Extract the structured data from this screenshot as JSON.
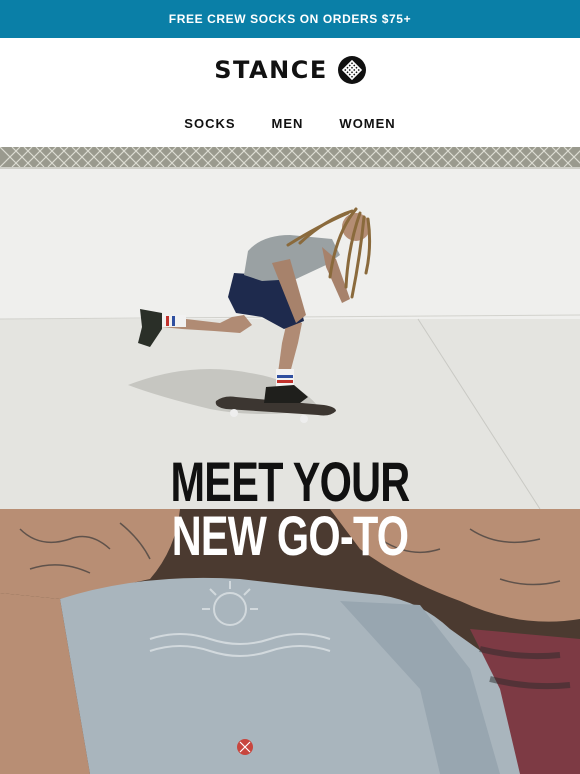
{
  "promo": {
    "text": "FREE CREW SOCKS ON ORDERS $75+"
  },
  "brand": {
    "wordmark": "STANCE",
    "logo_icon": "stance-emblem-icon"
  },
  "nav": {
    "items": [
      {
        "label": "SOCKS"
      },
      {
        "label": "MEN"
      },
      {
        "label": "WOMEN"
      }
    ]
  },
  "hero": {
    "image": "skateboarder-photo",
    "headline_line1": "MEET YOUR",
    "headline_line2": "NEW GO-TO"
  },
  "lower": {
    "image": "shirt-closeup-photo"
  },
  "colors": {
    "promo_bg": "#0a7fa7",
    "text": "#111111",
    "white": "#ffffff"
  }
}
